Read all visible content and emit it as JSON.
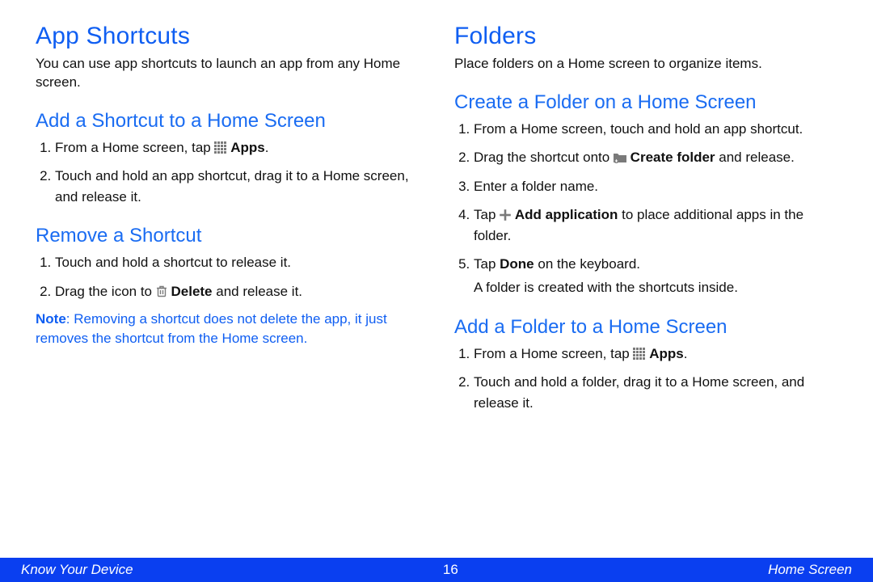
{
  "left": {
    "h1": "App Shortcuts",
    "intro": "You can use app shortcuts to launch an app from any Home screen.",
    "addShortcut": {
      "h2": "Add a Shortcut to a Home Screen",
      "step1_a": "From a Home screen, tap ",
      "step1_b": "Apps",
      "step1_c": ".",
      "step2": "Touch and hold an app shortcut, drag it to a Home screen, and release it."
    },
    "removeShortcut": {
      "h2": "Remove a Shortcut",
      "step1": "Touch and hold a shortcut to release it.",
      "step2_a": "Drag the icon to ",
      "step2_b": "Delete",
      "step2_c": " and release it.",
      "noteLabel": "Note",
      "noteBody": ": Removing a shortcut does not delete the app, it just removes the shortcut from the Home screen."
    }
  },
  "right": {
    "h1": "Folders",
    "intro": "Place folders on a Home screen to organize items.",
    "createFolder": {
      "h2": "Create a Folder on a Home Screen",
      "step1": "From a Home screen, touch and hold an app shortcut.",
      "step2_a": "Drag the shortcut onto ",
      "step2_b": "Create folder",
      "step2_c": " and release.",
      "step3": "Enter a folder name.",
      "step4_a": "Tap ",
      "step4_b": "Add application",
      "step4_c": " to place additional apps in the folder.",
      "step5_a": "Tap ",
      "step5_b": "Done",
      "step5_c": " on the keyboard.",
      "result": "A folder is created with the shortcuts inside."
    },
    "addFolder": {
      "h2": "Add a Folder to a Home Screen",
      "step1_a": "From a Home screen, tap ",
      "step1_b": "Apps",
      "step1_c": ".",
      "step2": "Touch and hold a folder, drag it to a Home screen, and release it."
    }
  },
  "footer": {
    "left": "Know Your Device",
    "page": "16",
    "right": "Home Screen"
  }
}
